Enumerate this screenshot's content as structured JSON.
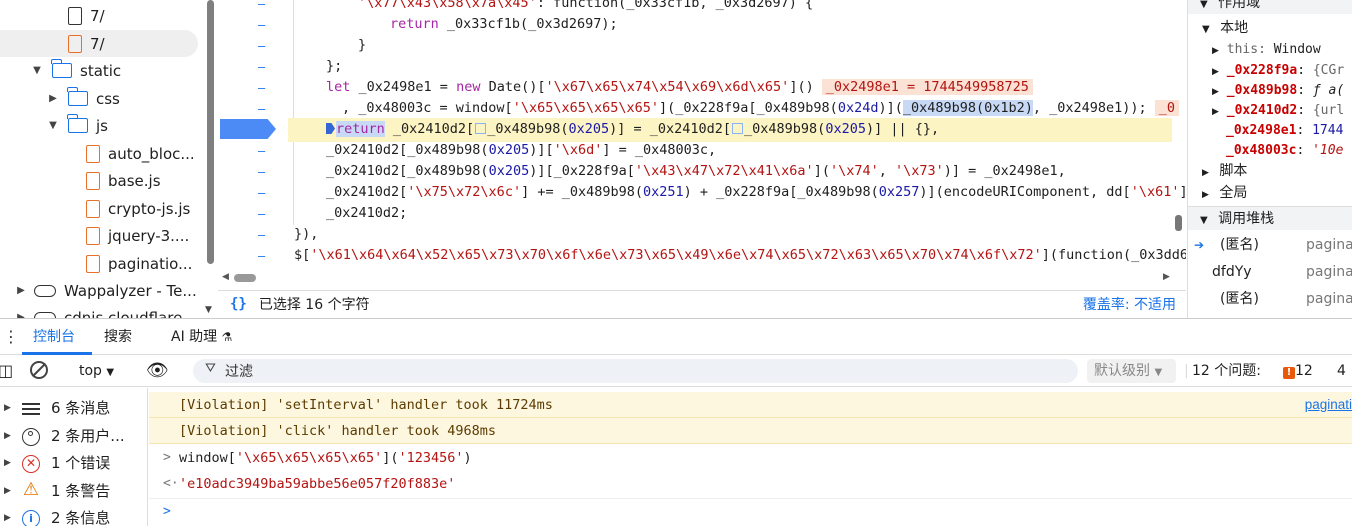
{
  "file_tree": {
    "items": [
      {
        "label": "7/",
        "kind": "file",
        "color": "#333333"
      },
      {
        "label": "7/",
        "kind": "file",
        "color": "#e8712a"
      },
      {
        "label": "static",
        "kind": "folder"
      },
      {
        "label": "css",
        "kind": "folder"
      },
      {
        "label": "js",
        "kind": "folder"
      },
      {
        "label": "auto_bloc...",
        "kind": "file"
      },
      {
        "label": "base.js",
        "kind": "file"
      },
      {
        "label": "crypto-js.js",
        "kind": "file"
      },
      {
        "label": "jquery-3....",
        "kind": "file"
      },
      {
        "label": "paginatio...",
        "kind": "file"
      },
      {
        "label": "Wappalyzer - Te...",
        "kind": "cloud"
      },
      {
        "label": "cdnjs.cloudflare...",
        "kind": "cloud"
      }
    ]
  },
  "code": {
    "l0a": "'\\x77\\x43\\x58\\x7a\\x45'",
    "l0b": ": function(_0x33cf1b, _0x3d2697) {",
    "l1a": "return",
    "l1b": " _0x33cf1b(_0x3d2697);",
    "l2": "}",
    "l3": "};",
    "l4a": "let",
    "l4b": " _0x2498e1 = ",
    "l4c": "new",
    "l4d": " Date()[",
    "l4e": "'\\x67\\x65\\x74\\x54\\x69\\x6d\\x65'",
    "l4f": "]()",
    "l4g": "_0x2498e1 = 1744549958725",
    "l5a": ", _0x48003c = window[",
    "l5b": "'\\x65\\x65\\x65\\x65'",
    "l5c": "](_0x228f9a[_0x489b98(",
    "l5d": "0x24d",
    "l5e": ")](",
    "l5f": "_0x489b98(0x1b2)",
    "l5g": ", _0x2498e1));",
    "l5h": "_0",
    "l6a": "return",
    "l6b": " _0x2410d2[",
    "l6c": "_0x489b98(",
    "l6d": "0x205",
    "l6e": ")] = _0x2410d2[",
    "l6f": "_0x489b98(",
    "l6g": "0x205",
    "l6h": ")] || {},",
    "l7a": "_0x2410d2[_0x489b98(",
    "l7b": "0x205",
    "l7c": ")][",
    "l7d": "'\\x6d'",
    "l7e": "] = _0x48003c,",
    "l8a": "_0x2410d2[_0x489b98(",
    "l8b": "0x205",
    "l8c": ")][_0x228f9a[",
    "l8d": "'\\x43\\x47\\x72\\x41\\x6a'",
    "l8e": "](",
    "l8f": "'\\x74'",
    "l8g": ", ",
    "l8h": "'\\x73'",
    "l8i": ")] = _0x2498e1,",
    "l9a": "_0x2410d2[",
    "l9b": "'\\x75\\x72\\x6c'",
    "l9c": "] += _0x489b98(",
    "l9d": "0x251",
    "l9e": ") + _0x228f9a[_0x489b98(",
    "l9f": "0x257",
    "l9g": ")](encodeURIComponent, dd[",
    "l9h": "'\\x61'",
    "l9i": "]",
    "l10": "_0x2410d2;",
    "l11": "}),",
    "l12a": "$[",
    "l12b": "'\\x61\\x64\\x64\\x52\\x65\\x73\\x70\\x6f\\x6e\\x73\\x65\\x49\\x6e\\x74\\x65\\x72\\x63\\x65\\x70\\x74\\x6f\\x72'",
    "l12c": "](function(_0x3dd6"
  },
  "editor_status": {
    "selection": "已选择 16 个字符",
    "coverage": "覆盖率: 不适用"
  },
  "scope": {
    "header": "作用域",
    "local": "本地",
    "this_key": "this",
    "this_val": "Window",
    "vars": [
      {
        "name": "_0x228f9a",
        "value": "{CGr"
      },
      {
        "name": "_0x489b98",
        "value": "ƒ a("
      },
      {
        "name": "_0x2410d2",
        "value": "{url"
      },
      {
        "name": "_0x2498e1",
        "value": "1744"
      },
      {
        "name": "_0x48003c",
        "value": "'10e"
      }
    ],
    "script": "脚本",
    "global": "全局"
  },
  "callstack": {
    "header": "调用堆栈",
    "frames": [
      {
        "name": "(匿名)",
        "loc": "pagina"
      },
      {
        "name": "dfdYy",
        "loc": "pagina"
      },
      {
        "name": "(匿名)",
        "loc": "pagina"
      }
    ]
  },
  "drawer_tabs": {
    "console": "控制台",
    "search": "搜索",
    "ai": "AI 助理"
  },
  "console_toolbar": {
    "context": "top",
    "filter_placeholder": "过滤",
    "level": "默认级别",
    "issues_label": "12 个问题:",
    "issues_count": "12",
    "other_count": "4"
  },
  "console_sidebar": [
    {
      "label": "6 条消息",
      "icon": "list-icon"
    },
    {
      "label": "2 条用户...",
      "icon": "user-icon"
    },
    {
      "label": "1 个错误",
      "icon": "error-icon"
    },
    {
      "label": "1 条警告",
      "icon": "warning-icon"
    },
    {
      "label": "2 条信息",
      "icon": "info-icon"
    }
  ],
  "console_messages": {
    "warn1": "[Violation] 'setInterval' handler took 11724ms",
    "warn1_src": "paginati",
    "warn2": "[Violation] 'click' handler took 4968ms",
    "input_a": "window[",
    "input_b": "'\\x65\\x65\\x65\\x65'",
    "input_c": "](",
    "input_d": "'123456'",
    "input_e": ")",
    "result": "'e10adc3949ba59abbe56e057f20f883e'"
  },
  "colors": {
    "accent": "#1a73e8",
    "string": "#b31412",
    "keyword": "#a626a4",
    "warning_bg": "#fef7e0",
    "exec_line_bg": "#fdf4c4"
  }
}
